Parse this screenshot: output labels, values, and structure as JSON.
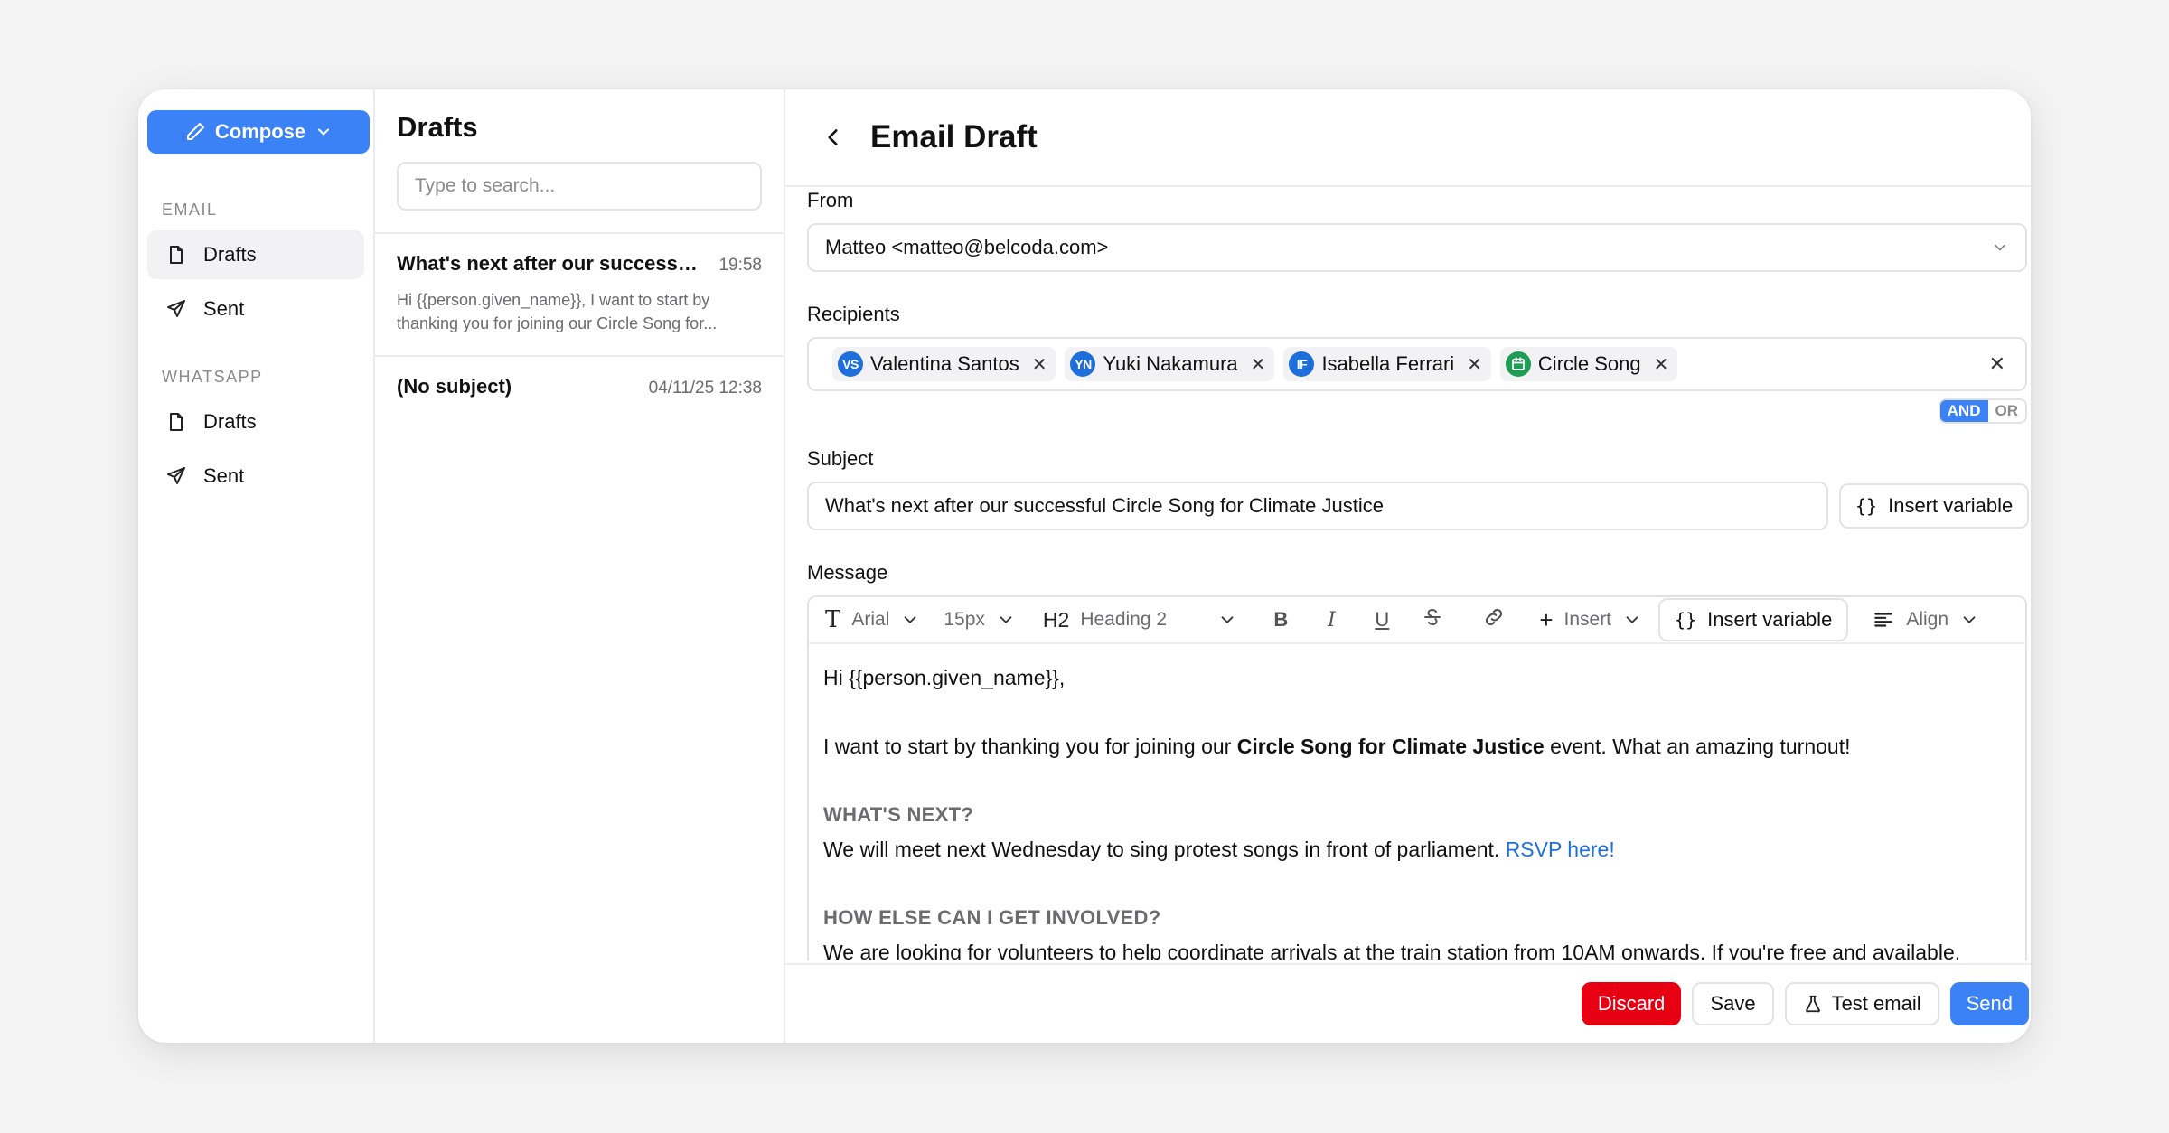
{
  "sidebar": {
    "compose_label": "Compose",
    "email_section": "EMAIL",
    "email_items": [
      {
        "label": "Drafts"
      },
      {
        "label": "Sent"
      }
    ],
    "whatsapp_section": "WHATSAPP",
    "whatsapp_items": [
      {
        "label": "Drafts"
      },
      {
        "label": "Sent"
      }
    ]
  },
  "drafts": {
    "title": "Drafts",
    "search_placeholder": "Type to search...",
    "items": [
      {
        "subject": "What's next after our successful...",
        "time": "19:58",
        "preview": "Hi {{person.given_name}}, I want to start by thanking you for joining our Circle Song for..."
      },
      {
        "subject": "(No subject)",
        "time": "04/11/25 12:38",
        "preview": ""
      }
    ]
  },
  "main": {
    "title": "Email Draft",
    "from_label": "From",
    "from_value": "Matteo <matteo@belcoda.com>",
    "recipients_label": "Recipients",
    "recipients": [
      {
        "initials": "VS",
        "name": "Valentina Santos"
      },
      {
        "initials": "YN",
        "name": "Yuki Nakamura"
      },
      {
        "initials": "IF",
        "name": "Isabella Ferrari"
      },
      {
        "initials": "",
        "name": "Circle Song"
      }
    ],
    "logic_and": "AND",
    "logic_or": "OR",
    "subject_label": "Subject",
    "subject_value": "What's next after our successful Circle Song for Climate Justice",
    "insert_variable": "Insert variable",
    "message_label": "Message",
    "toolbar": {
      "font": "Arial",
      "size": "15px",
      "heading_badge": "H2",
      "heading": "Heading 2",
      "bold": "B",
      "italic": "I",
      "underline": "U",
      "insert": "Insert",
      "insert_variable": "Insert variable",
      "align": "Align"
    },
    "body": {
      "greeting": "Hi {{person.given_name}},",
      "p1_before": "I want to start by thanking you for joining our ",
      "p1_bold": "Circle Song for Climate Justice",
      "p1_after": " event. What an amazing turnout!",
      "h1": "WHAT'S NEXT?",
      "p2": "We will meet next Wednesday to sing protest songs in front of parliament. ",
      "p2_link": "RSVP here!",
      "h2": "HOW ELSE CAN I GET INVOLVED?",
      "p3": "We are looking for volunteers to help coordinate arrivals at the train station from 10AM onwards. If you're free and available,"
    },
    "footer": {
      "discard": "Discard",
      "save": "Save",
      "test_email": "Test email",
      "send": "Send"
    }
  }
}
